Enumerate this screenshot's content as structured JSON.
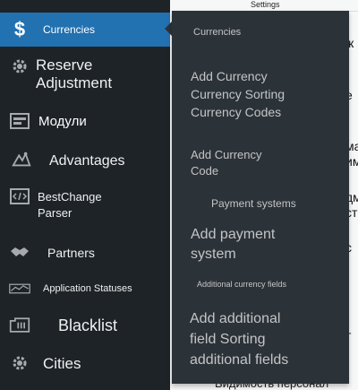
{
  "background": {
    "top_label": "Settings",
    "fragments": [
      "ж",
      "е",
      "ма",
      "им",
      "дм",
      "ст",
      "с",
      "т"
    ],
    "bottom_text": "Видимость персонал"
  },
  "sidebar": {
    "items": [
      {
        "label": "Currencies",
        "icon": "dollar-icon"
      },
      {
        "label": "Reserve\nAdjustment",
        "icon": "gear-icon"
      },
      {
        "label": "Модули",
        "icon": "modules-icon"
      },
      {
        "label": "Advantages",
        "icon": "advantages-icon"
      },
      {
        "label": "BestChange\nParser",
        "icon": "code-icon"
      },
      {
        "label": "Partners",
        "icon": "handshake-icon"
      },
      {
        "label": "Application Statuses",
        "icon": "chart-icon"
      },
      {
        "label": "Blacklist",
        "icon": "blacklist-icon"
      },
      {
        "label": "Cities",
        "icon": "gear-icon"
      }
    ]
  },
  "flyout": {
    "heading": "Currencies",
    "group1": "Add Currency\nCurrency Sorting\nCurrency Codes",
    "group2": "Add Currency\nCode",
    "payment_heading": "Payment systems",
    "add_payment": "Add payment\nsystem",
    "additional_heading": "Additional currency fields",
    "additional": "Add additional\nfield Sorting\nadditional fields"
  },
  "colors": {
    "sidebar": "#1d2327",
    "active": "#2271b1",
    "flyout": "#2c3338",
    "text": "#f0f0f1"
  }
}
